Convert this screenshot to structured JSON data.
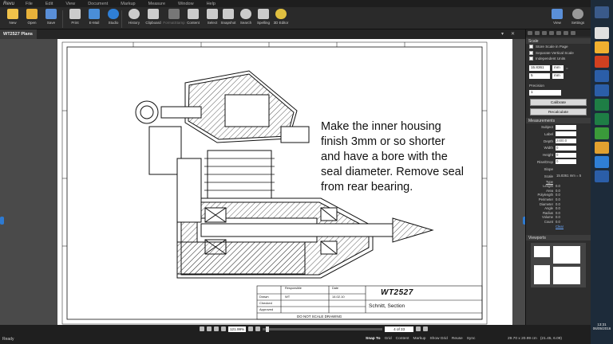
{
  "app": {
    "logo": "Revu"
  },
  "menu": [
    "File",
    "Edit",
    "View",
    "Document",
    "Markup",
    "Measure",
    "Window",
    "Help"
  ],
  "ribbon": {
    "buttons": [
      {
        "label": "New",
        "icon": "new-icon",
        "color": "#f0c24a"
      },
      {
        "label": "Open",
        "icon": "open-folder-icon",
        "color": "#e8b23a"
      },
      {
        "label": "Save",
        "icon": "save-icon",
        "color": "#5a8fd8"
      },
      {
        "label": "Print",
        "icon": "print-icon",
        "color": "#cccccc"
      },
      {
        "label": "E-Mail",
        "icon": "email-icon",
        "color": "#4a8ed8"
      },
      {
        "label": "Studio",
        "icon": "studio-cloud-icon",
        "color": "#2f7fd6"
      },
      {
        "label": "History",
        "icon": "history-icon",
        "color": "#cccccc"
      },
      {
        "label": "Clipboard",
        "icon": "clipboard-icon",
        "color": "#cccccc"
      },
      {
        "label": "FormatStamp",
        "icon": "format-painter-icon",
        "color": "#777777"
      },
      {
        "label": "Content",
        "icon": "content-icon",
        "color": "#cccccc"
      },
      {
        "label": "Select",
        "icon": "select-icon",
        "color": "#cccccc"
      },
      {
        "label": "Snapshot",
        "icon": "snapshot-icon",
        "color": "#cccccc"
      },
      {
        "label": "Search",
        "icon": "search-icon",
        "color": "#cccccc"
      },
      {
        "label": "Spelling",
        "icon": "spelling-icon",
        "color": "#cccccc"
      },
      {
        "label": "3D Editor",
        "icon": "3d-editor-icon",
        "color": "#e0c040"
      }
    ],
    "right_buttons": [
      {
        "label": "View",
        "icon": "view-icon"
      },
      {
        "label": "Settings",
        "icon": "settings-gear-icon"
      }
    ]
  },
  "tab": {
    "title": "WT2527 Plans"
  },
  "note": {
    "lines": [
      "Make the inner housing",
      "finish 3mm or so shorter",
      "and have a bore with the",
      "seal diameter. Remove seal",
      "from rear bearing."
    ]
  },
  "title_block": {
    "drawing_no": "WT2527",
    "title": "Schnitt, Section",
    "footer": "DO NOT SCALE DRAWING",
    "rows": [
      "Drawn",
      "Checked",
      "Approved"
    ],
    "drawn_by": "WT",
    "date": "14.02.10",
    "hdr_resp": "Responsible",
    "hdr_date": "Date"
  },
  "scale_panel": {
    "header": "Scale",
    "options": [
      "Store Scale in Page",
      "Separate Vertical Scale",
      "Independent Units"
    ],
    "ratio_left": "15.8361",
    "ratio_left_unit": "mm",
    "ratio_right": "5",
    "ratio_right_unit": "mm",
    "precision_label": "Precision",
    "precision_value": "1",
    "calibrate": "Calibrate",
    "recalculate": "Recalculate"
  },
  "measurements_panel": {
    "header": "Measurements",
    "fields": [
      {
        "label": "Subject",
        "value": ""
      },
      {
        "label": "Label",
        "value": ""
      },
      {
        "label": "Depth",
        "value": "2400.0"
      },
      {
        "label": "Width",
        "value": "0"
      },
      {
        "label": "Height",
        "value": "0"
      },
      {
        "label": "Rise/Drop",
        "value": "0"
      },
      {
        "label": "Slope",
        "value": ""
      },
      {
        "label": "Scale",
        "value": "15.8361 mm = 5"
      }
    ],
    "type_label": "Type",
    "types": [
      {
        "label": "Length",
        "value": "0.0"
      },
      {
        "label": "Area",
        "value": "0.0"
      },
      {
        "label": "Polylength",
        "value": "0.0"
      },
      {
        "label": "Perimeter",
        "value": "0.0"
      },
      {
        "label": "Diameter",
        "value": "0.0"
      },
      {
        "label": "Angle",
        "value": "0.0"
      },
      {
        "label": "Radius",
        "value": "0.0"
      },
      {
        "label": "Volume",
        "value": "0.0"
      },
      {
        "label": "Count",
        "value": "0.0"
      }
    ],
    "clear": "Clear",
    "viewports": "Viewports"
  },
  "nav": {
    "zoom": "121.99%",
    "page": "4 of 33"
  },
  "status": {
    "ready": "Ready",
    "items": [
      "Snap To",
      "Grid",
      "Content",
      "Markup",
      "Show Grid",
      "Reuse",
      "Sync"
    ],
    "size": "29.70 x 20.99 cm",
    "coords": "(21.45, 6.09)"
  },
  "clock": {
    "time": "13:31",
    "date": "06/05/2016"
  }
}
